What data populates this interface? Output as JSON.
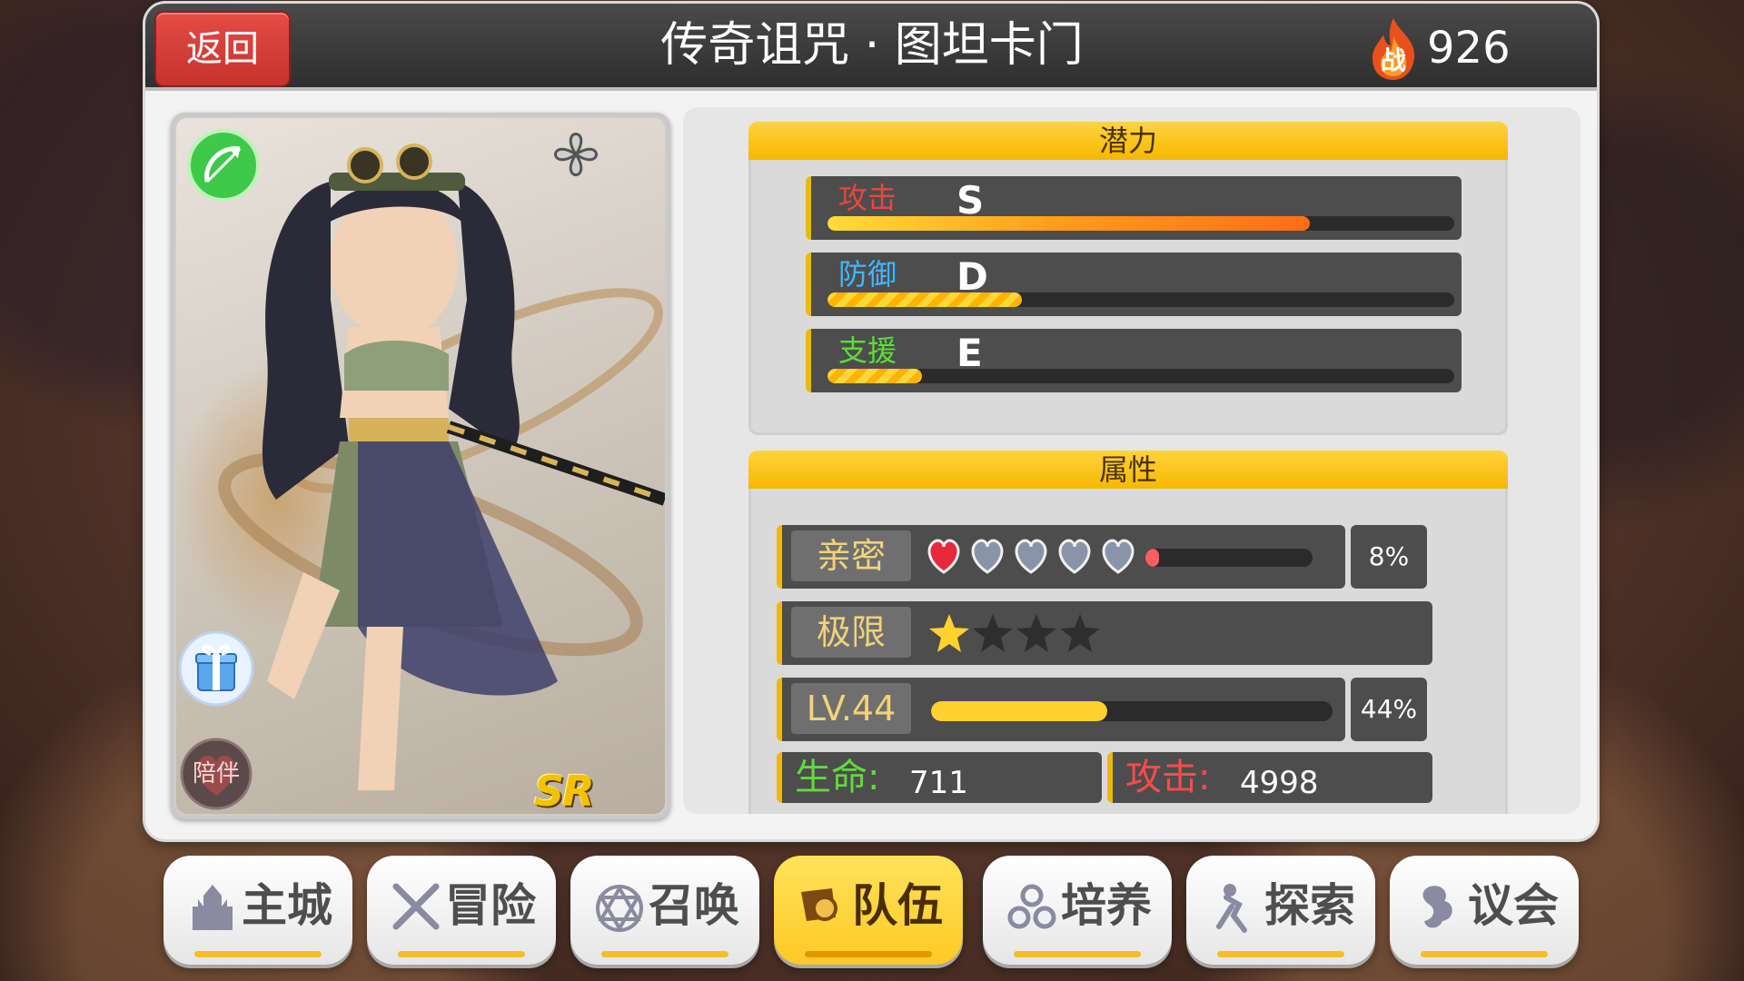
{
  "header": {
    "back_label": "返回",
    "title": "传奇诅咒 · 图坦卡门",
    "power_glyph": "战",
    "power_value": "926"
  },
  "card": {
    "rarity": "SR",
    "accompany_label": "陪伴",
    "class_icon": "bow-icon",
    "gift_icon": "gift-icon"
  },
  "potential": {
    "heading": "潜力",
    "rows": [
      {
        "label": "攻击",
        "grade": "S",
        "fill": 0.77,
        "color": "#e8473e"
      },
      {
        "label": "防御",
        "grade": "D",
        "fill": 0.31,
        "color": "#3fb6ff"
      },
      {
        "label": "支援",
        "grade": "E",
        "fill": 0.15,
        "color": "#5fdc3a"
      }
    ]
  },
  "attributes": {
    "heading": "属性",
    "intimacy": {
      "label": "亲密",
      "hearts_filled": 1,
      "hearts_total": 5,
      "progress": 0.08,
      "percent": "8%"
    },
    "limit": {
      "label": "极限",
      "stars_filled": 1,
      "stars_total": 4
    },
    "level": {
      "label": "LV.44",
      "progress": 0.44,
      "percent": "44%"
    },
    "stats": [
      {
        "label": "生命:",
        "value": "711",
        "color": "#5fdc3a"
      },
      {
        "label": "攻击:",
        "value": "4998",
        "color": "#ff4a4a"
      }
    ]
  },
  "nav": {
    "items": [
      {
        "label": "主城",
        "icon": "castle-icon",
        "active": false
      },
      {
        "label": "冒险",
        "icon": "crossed-swords-icon",
        "active": false
      },
      {
        "label": "召唤",
        "icon": "hexagram-icon",
        "active": false
      },
      {
        "label": "队伍",
        "icon": "team-icon",
        "active": true
      },
      {
        "label": "培养",
        "icon": "cultivate-icon",
        "active": false
      },
      {
        "label": "探索",
        "icon": "explore-icon",
        "active": false
      },
      {
        "label": "议会",
        "icon": "council-icon",
        "active": false
      }
    ]
  },
  "colors": {
    "accent": "#f6b800",
    "back": "#d93b35",
    "panel": "#f3f3f3"
  }
}
